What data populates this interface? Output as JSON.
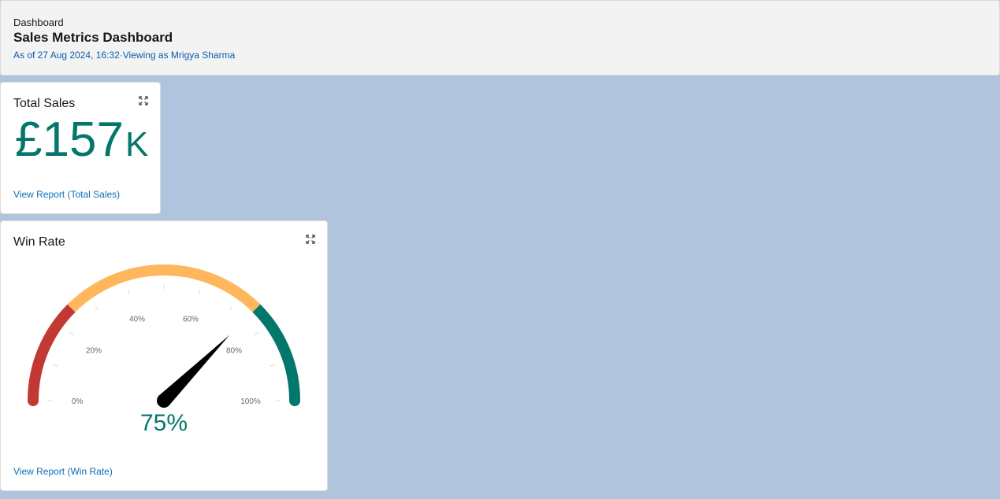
{
  "header": {
    "breadcrumb": "Dashboard",
    "title": "Sales Metrics Dashboard",
    "subtitle": "As of 27 Aug 2024, 16:32·Viewing as Mrigya Sharma"
  },
  "total_sales": {
    "title": "Total Sales",
    "value": "£157",
    "suffix": "K",
    "link": "View Report (Total Sales)",
    "expand_icon": "expand-icon"
  },
  "win_rate": {
    "title": "Win Rate",
    "value_label": "75%",
    "value": 75,
    "link": "View Report (Win Rate)",
    "expand_icon": "expand-icon",
    "ticks": [
      "0%",
      "20%",
      "40%",
      "60%",
      "80%",
      "100%"
    ],
    "segments": [
      {
        "from": 0,
        "to": 25,
        "color": "#c23934"
      },
      {
        "from": 25,
        "to": 75,
        "color": "#ffb75d"
      },
      {
        "from": 75,
        "to": 100,
        "color": "#04776c"
      }
    ],
    "needle_color": "#000000"
  },
  "colors": {
    "accent_teal": "#04776c",
    "link_blue": "#0b6fb9",
    "background": "#b0c4de"
  }
}
